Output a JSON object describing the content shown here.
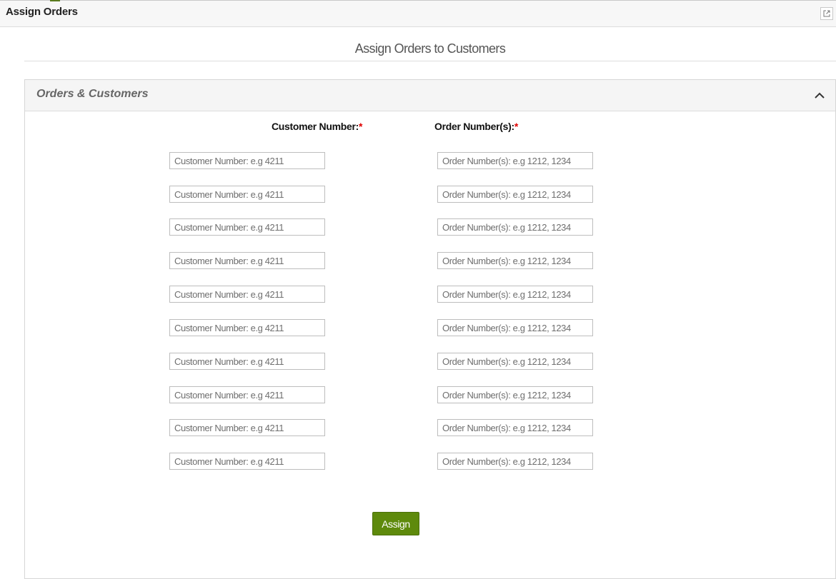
{
  "window": {
    "title": "Assign Orders",
    "popout_icon": "external-link-icon"
  },
  "page": {
    "heading": "Assign Orders to Customers"
  },
  "panel": {
    "title": "Orders & Customers",
    "collapse_icon": "chevron-up-icon",
    "columns": {
      "customer_label": "Customer Number:",
      "order_label": "Order Number(s):",
      "required_marker": "*"
    },
    "rows": [
      {
        "customer_placeholder": "Customer Number: e.g 4211",
        "order_placeholder": "Order Number(s): e.g 1212, 1234",
        "customer_value": "",
        "order_value": ""
      },
      {
        "customer_placeholder": "Customer Number: e.g 4211",
        "order_placeholder": "Order Number(s): e.g 1212, 1234",
        "customer_value": "",
        "order_value": ""
      },
      {
        "customer_placeholder": "Customer Number: e.g 4211",
        "order_placeholder": "Order Number(s): e.g 1212, 1234",
        "customer_value": "",
        "order_value": ""
      },
      {
        "customer_placeholder": "Customer Number: e.g 4211",
        "order_placeholder": "Order Number(s): e.g 1212, 1234",
        "customer_value": "",
        "order_value": ""
      },
      {
        "customer_placeholder": "Customer Number: e.g 4211",
        "order_placeholder": "Order Number(s): e.g 1212, 1234",
        "customer_value": "",
        "order_value": ""
      },
      {
        "customer_placeholder": "Customer Number: e.g 4211",
        "order_placeholder": "Order Number(s): e.g 1212, 1234",
        "customer_value": "",
        "order_value": ""
      },
      {
        "customer_placeholder": "Customer Number: e.g 4211",
        "order_placeholder": "Order Number(s): e.g 1212, 1234",
        "customer_value": "",
        "order_value": ""
      },
      {
        "customer_placeholder": "Customer Number: e.g 4211",
        "order_placeholder": "Order Number(s): e.g 1212, 1234",
        "customer_value": "",
        "order_value": ""
      },
      {
        "customer_placeholder": "Customer Number: e.g 4211",
        "order_placeholder": "Order Number(s): e.g 1212, 1234",
        "customer_value": "",
        "order_value": ""
      },
      {
        "customer_placeholder": "Customer Number: e.g 4211",
        "order_placeholder": "Order Number(s): e.g 1212, 1234",
        "customer_value": "",
        "order_value": ""
      }
    ],
    "assign_button_label": "Assign"
  },
  "colors": {
    "accent_green": "#5e8a0c",
    "required_red": "#e00000"
  }
}
